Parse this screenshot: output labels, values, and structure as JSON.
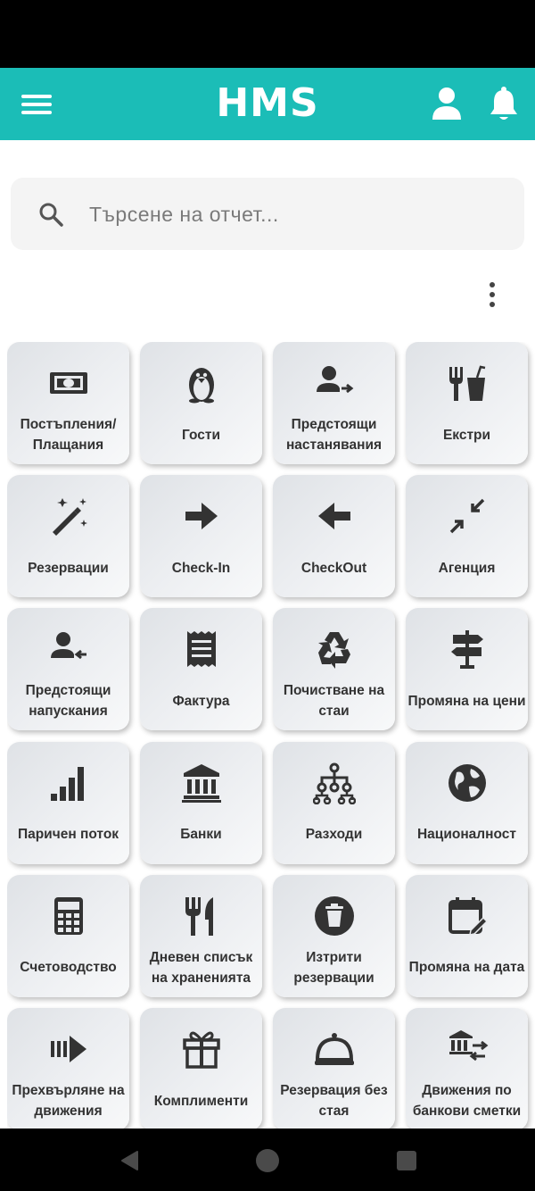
{
  "app": {
    "title": "HMS",
    "accent_color": "#1bbdb7"
  },
  "header": {
    "menu_icon": "menu-icon",
    "user_icon": "user-icon",
    "bell_icon": "bell-icon"
  },
  "search": {
    "placeholder": "Търсене на отчет...",
    "value": ""
  },
  "reports": [
    {
      "label": "Постъпления/\nПлащания",
      "icon": "money-bill"
    },
    {
      "label": "Гости",
      "icon": "penguin"
    },
    {
      "label": "Предстоящи\nнастанявания",
      "icon": "user-arrow-right"
    },
    {
      "label": "Екстри",
      "icon": "fork-drink"
    },
    {
      "label": "Резервации",
      "icon": "magic-wand"
    },
    {
      "label": "Check-In",
      "icon": "arrow-right"
    },
    {
      "label": "CheckOut",
      "icon": "arrow-left"
    },
    {
      "label": "Агенция",
      "icon": "compress"
    },
    {
      "label": "Предстоящи\nнапускания",
      "icon": "user-arrow-left"
    },
    {
      "label": "Фактура",
      "icon": "receipt"
    },
    {
      "label": "Почистване на\nстаи",
      "icon": "recycle"
    },
    {
      "label": "Промяна на цени",
      "icon": "signpost"
    },
    {
      "label": "Паричен поток",
      "icon": "signal-bars"
    },
    {
      "label": "Банки",
      "icon": "bank"
    },
    {
      "label": "Разходи",
      "icon": "sitemap"
    },
    {
      "label": "Националност",
      "icon": "globe"
    },
    {
      "label": "Счетоводство",
      "icon": "calculator"
    },
    {
      "label": "Дневен списък\nна храненията",
      "icon": "utensils"
    },
    {
      "label": "Изтрити\nрезервации",
      "icon": "trash-circle"
    },
    {
      "label": "Промяна на дата",
      "icon": "calendar-edit"
    },
    {
      "label": "Прехвърляне на\nдвижения",
      "icon": "forward-bars"
    },
    {
      "label": "Комплименти",
      "icon": "gift"
    },
    {
      "label": "Резервация без\nстая",
      "icon": "cloche"
    },
    {
      "label": "Движения по\nбанкови сметки",
      "icon": "bank-transfer"
    }
  ]
}
